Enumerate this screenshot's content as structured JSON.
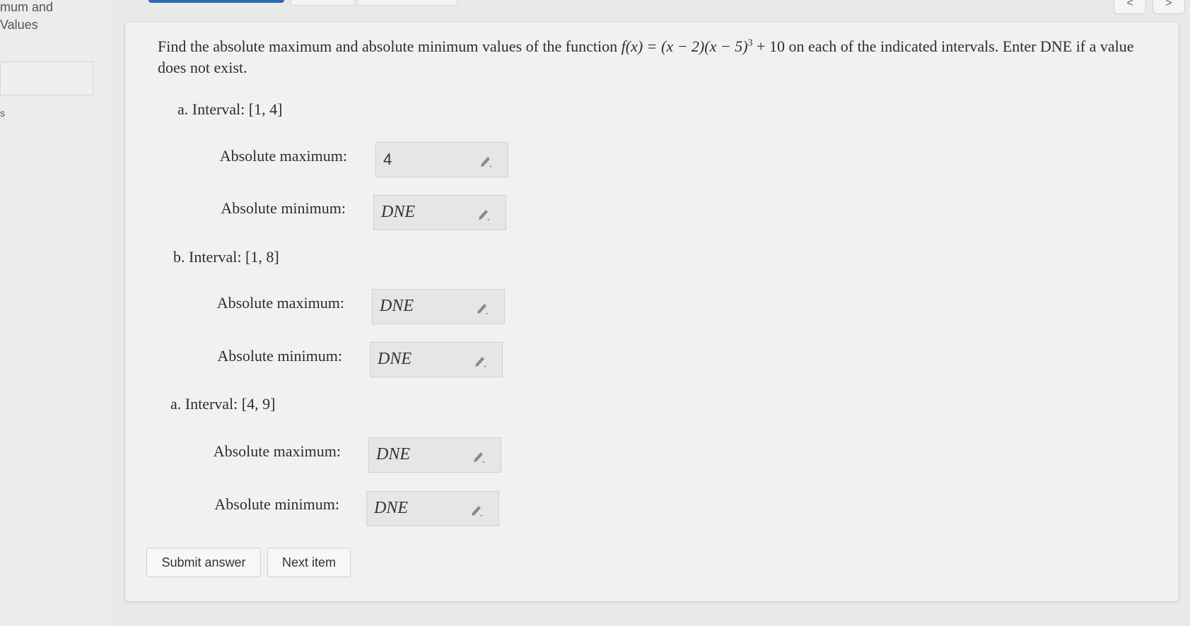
{
  "sidebar": {
    "line1": "mum and",
    "line2": "Values",
    "line3": "s"
  },
  "nav": {
    "prev": "<",
    "next": ">"
  },
  "question": {
    "prefix": "Find the absolute maximum and absolute minimum values of the function ",
    "func": "f(x) = (x − 2)(x − 5)",
    "exp": "3",
    "func_tail": " + 10",
    "suffix": " on each of the indicated intervals. Enter DNE if a value does not exist."
  },
  "parts": [
    {
      "label": "a. Interval: [1, 4]",
      "max_label": "Absolute maximum:",
      "max_value": "4",
      "min_label": "Absolute minimum:",
      "min_value": "DNE"
    },
    {
      "label": "b. Interval: [1, 8]",
      "max_label": "Absolute maximum:",
      "max_value": "DNE",
      "min_label": "Absolute minimum:",
      "min_value": "DNE"
    },
    {
      "label": "a. Interval: [4, 9]",
      "max_label": "Absolute maximum:",
      "max_value": "DNE",
      "min_label": "Absolute minimum:",
      "min_value": "DNE"
    }
  ],
  "buttons": {
    "submit": "Submit answer",
    "next_item": "Next item"
  },
  "colors": {
    "background": "#e9e9e7",
    "panel": "#f1f1ef",
    "answer_box": "#e6e6e4",
    "accent": "#2b6cb0"
  },
  "icons": {
    "edit": "pencil-icon"
  }
}
